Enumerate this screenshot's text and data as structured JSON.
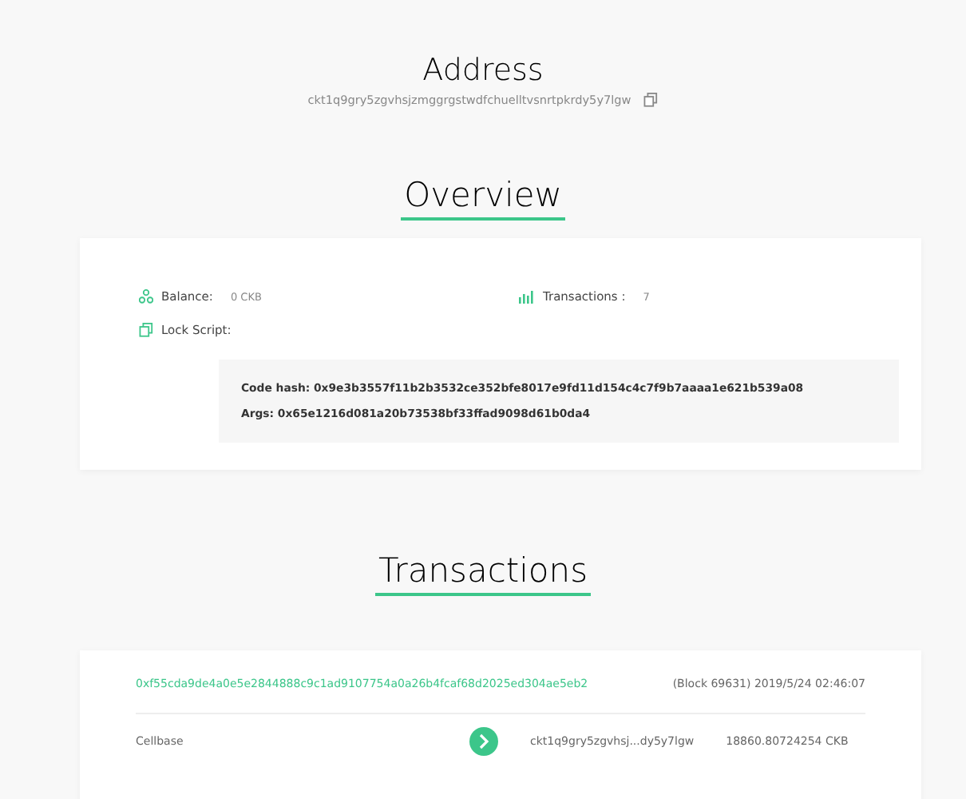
{
  "address": {
    "title": "Address",
    "value": "ckt1q9gry5zgvhsjzmggrgstwdfchuelltvsnrtpkrdy5y7lgw"
  },
  "overview": {
    "title": "Overview",
    "balance_label": "Balance:",
    "balance": "0 CKB",
    "transactions_label": "Transactions :",
    "transactions": "7",
    "lock_script_label": "Lock Script:",
    "code_hash": "Code hash: 0x9e3b3557f11b2b3532ce352bfe8017e9fd11d154c4c7f9b7aaaa1e621b539a08",
    "args": "Args: 0x65e1216d081a20b73538bf33ffad9098d61b0da4"
  },
  "transactions": {
    "title": "Transactions",
    "items": [
      {
        "hash": "0xf55cda9de4a0e5e2844888c9c1ad9107754a0a26b4fcaf68d2025ed304ae5eb2",
        "block": "(Block 69631) 2019/5/24 02:46:07",
        "input": "Cellbase",
        "output": "ckt1q9gry5zgvhsj...dy5y7lgw",
        "amount": "18860.80724254 CKB"
      }
    ]
  }
}
